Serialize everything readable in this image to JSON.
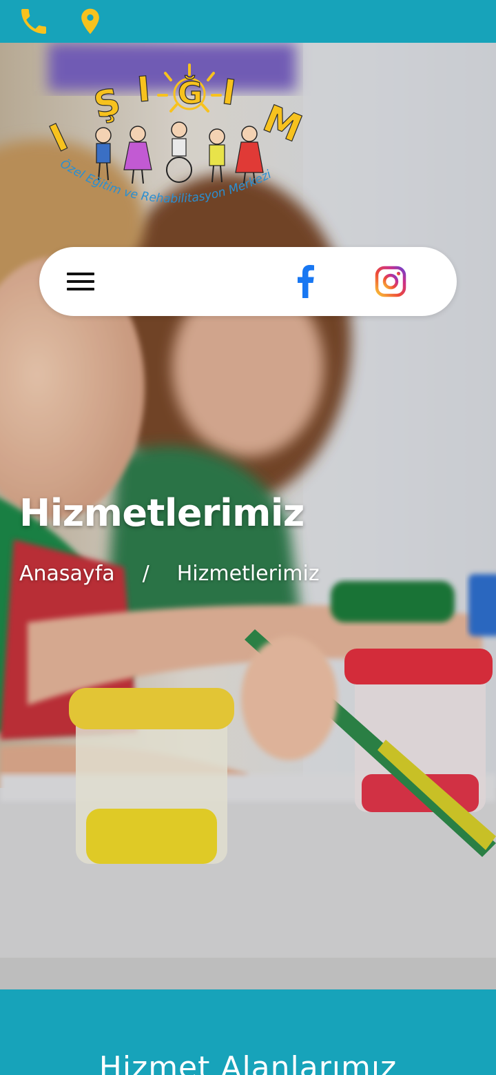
{
  "topbar": {
    "phone_icon": "phone-icon",
    "location_icon": "map-pin-icon",
    "icon_color": "#f7c21e",
    "background": "#17a3ba"
  },
  "logo": {
    "letters": [
      "I",
      "Ş",
      "I",
      "Ğ",
      "I",
      "M"
    ],
    "tagline": "Özel Eğitim ve Rehabilitasyon Merkezi"
  },
  "nav": {
    "menu_icon": "hamburger-menu-icon",
    "facebook_icon": "facebook-icon",
    "instagram_icon": "instagram-icon"
  },
  "hero": {
    "title": "Hizmetlerimiz",
    "breadcrumb": {
      "home": "Anasayfa",
      "separator": "/",
      "current": "Hizmetlerimiz"
    }
  },
  "services": {
    "title": "Hizmet Alanlarımız"
  }
}
